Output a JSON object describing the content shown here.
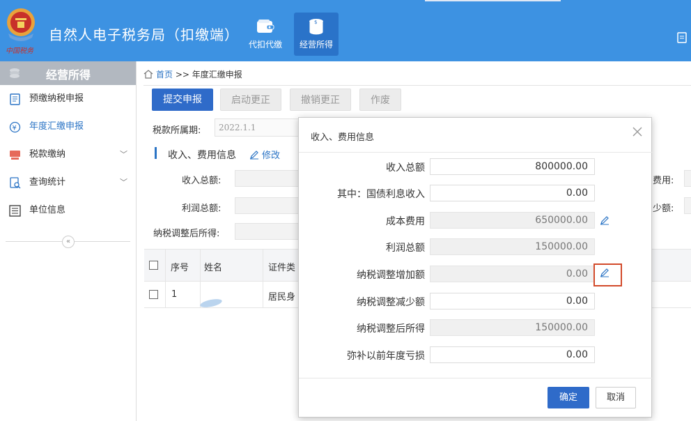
{
  "header": {
    "title": "自然人电子税务局（扣缴端）",
    "nav": [
      {
        "label": "代扣代缴",
        "icon": "wallet-icon",
        "active": false
      },
      {
        "label": "经营所得",
        "icon": "coins-icon",
        "active": true
      }
    ],
    "accent": "#3d92e2"
  },
  "sidebar": {
    "title": "经营所得",
    "items": [
      {
        "label": "预缴纳税申报",
        "icon": "form-icon"
      },
      {
        "label": "年度汇缴申报",
        "icon": "yen-icon"
      },
      {
        "label": "税款缴纳",
        "icon": "payment-icon"
      },
      {
        "label": "查询统计",
        "icon": "search-doc-icon"
      },
      {
        "label": "单位信息",
        "icon": "list-icon"
      }
    ],
    "collapse_symbol": "«"
  },
  "breadcrumb": {
    "home": "首页",
    "separator": ">>",
    "current": "年度汇缴申报"
  },
  "toolbar": {
    "submit": "提交申报",
    "start_correction": "启动更正",
    "cancel_correction": "撤销更正",
    "void": "作废"
  },
  "period": {
    "label": "税款所属期:",
    "value": "2022.1.1"
  },
  "section": {
    "title": "收入、费用信息",
    "edit": "修改"
  },
  "background_form": {
    "total_income": "收入总额:",
    "total_profit": "利润总额:",
    "adjusted_income": "纳税调整后所得:",
    "right_fee": "费用:",
    "right_reduce": "少额:"
  },
  "table": {
    "headers": [
      "序号",
      "姓名",
      "证件类型"
    ],
    "headers_visible": [
      "序号",
      "姓名",
      "证件类"
    ],
    "rows": [
      {
        "index": "1",
        "name": "",
        "id_type": "居民身"
      }
    ]
  },
  "modal": {
    "title": "收入、费用信息",
    "fields": [
      {
        "label": "收入总额",
        "value": "800000.00",
        "readonly": false,
        "editable_icon": false
      },
      {
        "label": "其中：国债利息收入",
        "value": "0.00",
        "readonly": false,
        "editable_icon": false
      },
      {
        "label": "成本费用",
        "value": "650000.00",
        "readonly": true,
        "editable_icon": true
      },
      {
        "label": "利润总额",
        "value": "150000.00",
        "readonly": true,
        "editable_icon": false
      },
      {
        "label": "纳税调整增加额",
        "value": "0.00",
        "readonly": true,
        "editable_icon": true
      },
      {
        "label": "纳税调整减少额",
        "value": "0.00",
        "readonly": false,
        "editable_icon": false
      },
      {
        "label": "纳税调整后所得",
        "value": "150000.00",
        "readonly": true,
        "editable_icon": false
      },
      {
        "label": "弥补以前年度亏损",
        "value": "0.00",
        "readonly": false,
        "editable_icon": false
      }
    ],
    "ok": "确定",
    "cancel": "取消"
  }
}
